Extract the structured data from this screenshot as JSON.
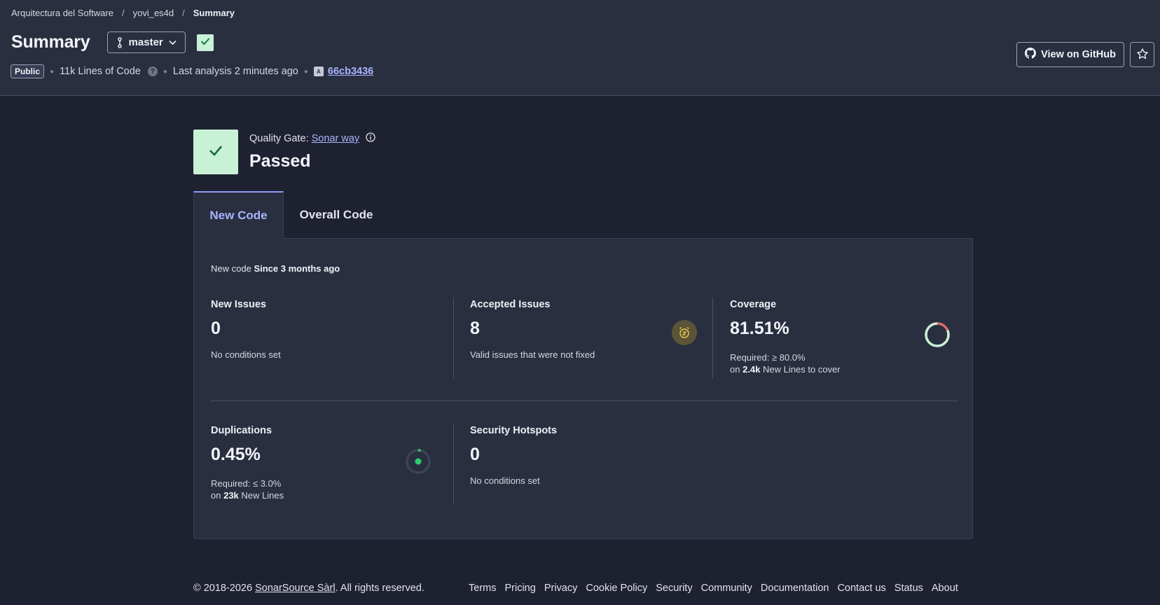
{
  "breadcrumb": {
    "items": [
      "Arquitectura del Software",
      "yovi_es4d",
      "Summary"
    ],
    "separator": "/"
  },
  "header": {
    "title": "Summary",
    "branch": "master",
    "visibility": "Public",
    "lines_of_code": "11k Lines of Code",
    "last_analysis": "Last analysis 2 minutes ago",
    "commit_badge": "A",
    "commit": "66cb3436",
    "github_button": "View on GitHub",
    "icons": [
      "branch-icon",
      "chevron-down-icon",
      "check-icon",
      "help-icon",
      "github-icon",
      "star-icon"
    ]
  },
  "quality_gate": {
    "label": "Quality Gate:",
    "profile": "Sonar way",
    "status": "Passed",
    "status_color": "#c8f1d5"
  },
  "tabs": [
    {
      "label": "New Code",
      "active": true
    },
    {
      "label": "Overall Code",
      "active": false
    }
  ],
  "new_code": {
    "prefix": "New code",
    "period": "Since 3 months ago"
  },
  "metrics": {
    "new_issues": {
      "title": "New Issues",
      "value": "0",
      "desc": "No conditions set"
    },
    "accepted_issues": {
      "title": "Accepted Issues",
      "value": "8",
      "desc": "Valid issues that were not fixed"
    },
    "coverage": {
      "title": "Coverage",
      "value": "81.51%",
      "required": "Required: ≥ 80.0%",
      "on_prefix": "on",
      "lines": "2.4k",
      "lines_suffix": "New Lines to cover",
      "percent": 81.51
    },
    "duplications": {
      "title": "Duplications",
      "value": "0.45%",
      "required": "Required: ≤ 3.0%",
      "on_prefix": "on",
      "lines": "23k",
      "lines_suffix": "New Lines",
      "percent": 0.45
    },
    "security_hotspots": {
      "title": "Security Hotspots",
      "value": "0",
      "desc": "No conditions set"
    }
  },
  "footer": {
    "copyright_prefix": "© 2018-2026",
    "company": "SonarSource Sàrl",
    "copyright_suffix": ". All rights reserved.",
    "links": [
      "Terms",
      "Pricing",
      "Privacy",
      "Cookie Policy",
      "Security",
      "Community",
      "Documentation",
      "Contact us",
      "Status",
      "About"
    ]
  },
  "colors": {
    "accent": "#a9b4ff",
    "success": "#c8f1d5",
    "coverage_ok": "#c8f1d5",
    "coverage_missing": "#e06c6c",
    "dup_green": "#2ecc71"
  }
}
